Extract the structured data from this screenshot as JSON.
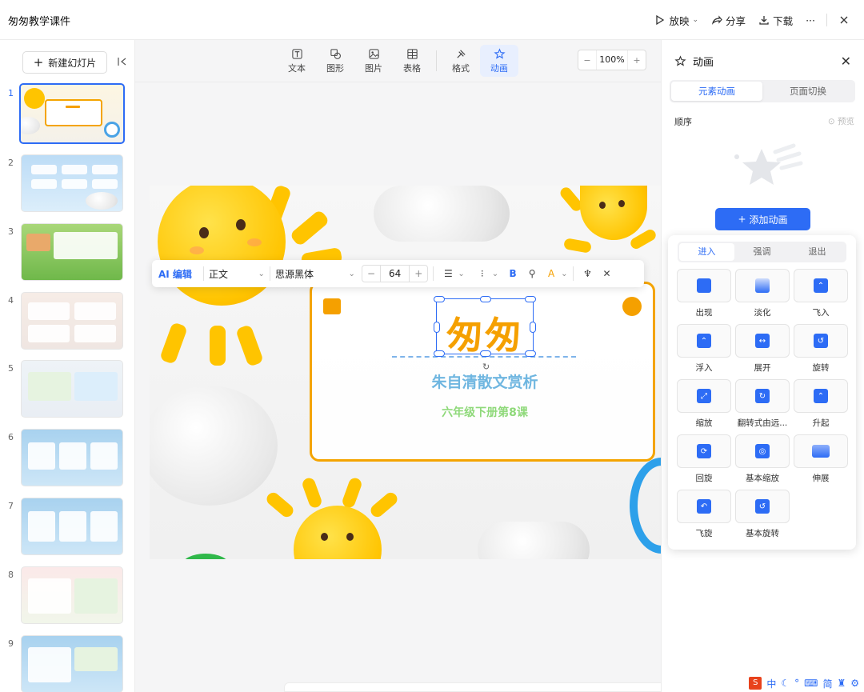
{
  "app": {
    "title": "匆匆教学课件"
  },
  "top_actions": {
    "play": "放映",
    "share": "分享",
    "download": "下载",
    "more": "···"
  },
  "left": {
    "new_slide_label": "新建幻灯片",
    "slides": [
      {
        "num": "1"
      },
      {
        "num": "2"
      },
      {
        "num": "3"
      },
      {
        "num": "4"
      },
      {
        "num": "5"
      },
      {
        "num": "6"
      },
      {
        "num": "7"
      },
      {
        "num": "8"
      },
      {
        "num": "9"
      }
    ]
  },
  "toolbar": {
    "tools": [
      {
        "label": "文本",
        "icon": "text-icon"
      },
      {
        "label": "图形",
        "icon": "shape-icon"
      },
      {
        "label": "图片",
        "icon": "image-icon"
      },
      {
        "label": "表格",
        "icon": "table-icon"
      },
      {
        "label": "格式",
        "icon": "format-brush-icon"
      },
      {
        "label": "动画",
        "icon": "animation-star-icon",
        "active": true
      }
    ],
    "zoom": "100%"
  },
  "float_toolbar": {
    "ai_label": "AI 编辑",
    "para_style": "正文",
    "font": "思源黑体",
    "size": "64"
  },
  "slide": {
    "title": "匆匆",
    "subtitle": "朱自清散文赏析",
    "grade": "六年级下册第8课"
  },
  "right": {
    "title": "动画",
    "tabs": [
      "元素动画",
      "页面切换"
    ],
    "order_label": "顺序",
    "preview_label": "预览",
    "add_button": "添加动画",
    "popup_tabs": [
      "进入",
      "强调",
      "退出"
    ],
    "effects": [
      {
        "label": "出现"
      },
      {
        "label": "淡化"
      },
      {
        "label": "飞入"
      },
      {
        "label": "浮入"
      },
      {
        "label": "展开"
      },
      {
        "label": "旋转"
      },
      {
        "label": "缩放"
      },
      {
        "label": "翻转式由远..."
      },
      {
        "label": "升起"
      },
      {
        "label": "回旋"
      },
      {
        "label": "基本缩放"
      },
      {
        "label": "伸展"
      },
      {
        "label": "飞旋"
      },
      {
        "label": "基本旋转"
      }
    ]
  },
  "ime": {
    "lang": "中",
    "simp": "简"
  }
}
